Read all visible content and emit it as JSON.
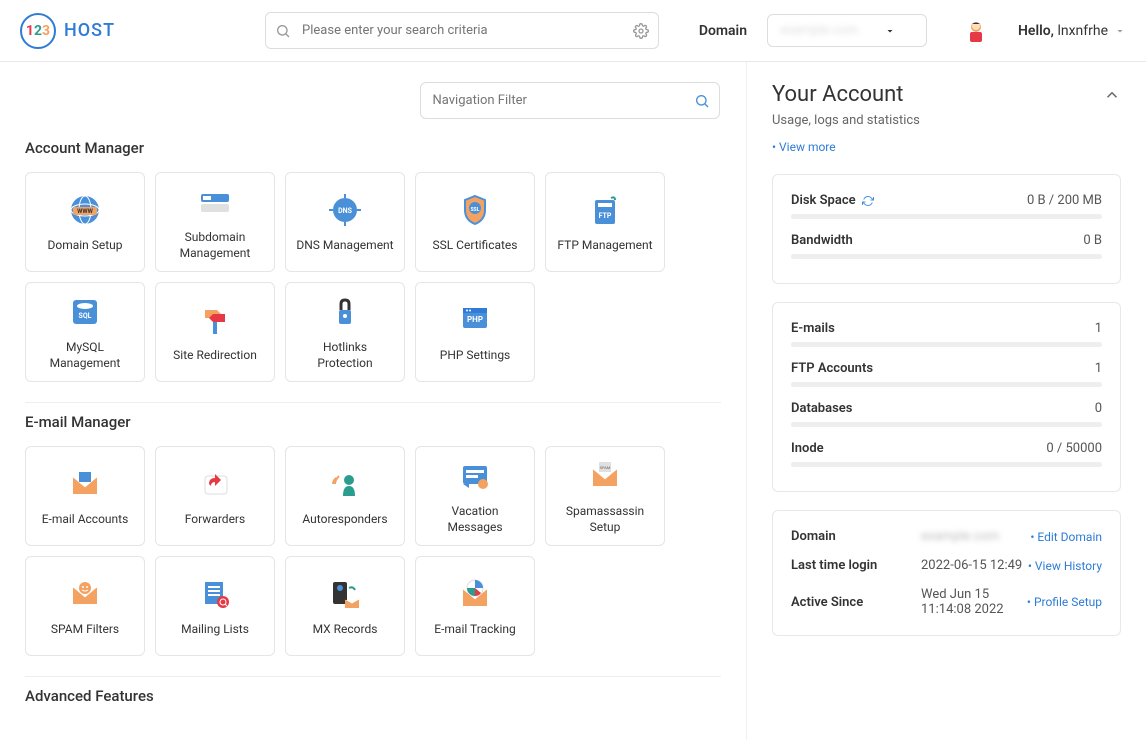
{
  "logo": {
    "text": "HOST"
  },
  "search": {
    "placeholder": "Please enter your search criteria"
  },
  "domain_label": "Domain",
  "greeting_prefix": "Hello,",
  "greeting_name": "lnxnfrhe",
  "nav_filter": {
    "placeholder": "Navigation Filter"
  },
  "sections": {
    "account_manager": {
      "title": "Account Manager",
      "tiles": [
        {
          "label": "Domain Setup"
        },
        {
          "label": "Subdomain Management"
        },
        {
          "label": "DNS Management"
        },
        {
          "label": "SSL Certificates"
        },
        {
          "label": "FTP Management"
        },
        {
          "label": "MySQL Management"
        },
        {
          "label": "Site Redirection"
        },
        {
          "label": "Hotlinks Protection"
        },
        {
          "label": "PHP Settings"
        }
      ]
    },
    "email_manager": {
      "title": "E-mail Manager",
      "tiles": [
        {
          "label": "E-mail Accounts"
        },
        {
          "label": "Forwarders"
        },
        {
          "label": "Autoresponders"
        },
        {
          "label": "Vacation Messages"
        },
        {
          "label": "Spamassassin Setup"
        },
        {
          "label": "SPAM Filters"
        },
        {
          "label": "Mailing Lists"
        },
        {
          "label": "MX Records"
        },
        {
          "label": "E-mail Tracking"
        }
      ]
    },
    "advanced": {
      "title": "Advanced Features"
    }
  },
  "account": {
    "title": "Your Account",
    "subtitle": "Usage, logs and statistics",
    "view_more": "• View more",
    "stats1": [
      {
        "label": "Disk Space",
        "value": "0 B / 200 MB",
        "refresh": true
      },
      {
        "label": "Bandwidth",
        "value": "0 B"
      }
    ],
    "stats2": [
      {
        "label": "E-mails",
        "value": "1"
      },
      {
        "label": "FTP Accounts",
        "value": "1"
      },
      {
        "label": "Databases",
        "value": "0"
      },
      {
        "label": "Inode",
        "value": "0 / 50000"
      }
    ],
    "info": [
      {
        "label": "Domain",
        "value": "",
        "link": "• Edit Domain",
        "blur": true
      },
      {
        "label": "Last time login",
        "value": "2022-06-15 12:49",
        "link": "• View History"
      },
      {
        "label": "Active Since",
        "value": "Wed Jun 15 11:14:08 2022",
        "link": "• Profile Setup"
      }
    ]
  }
}
